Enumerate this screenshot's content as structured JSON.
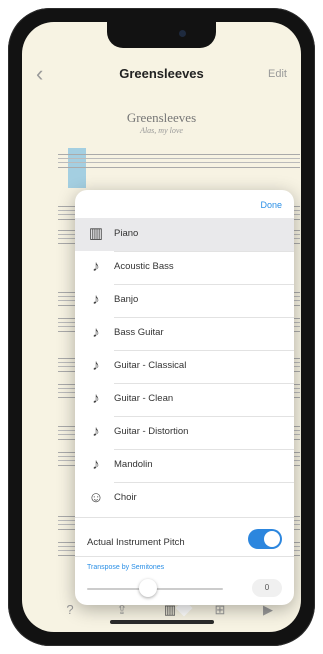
{
  "nav": {
    "back_icon": "chevron-left-icon",
    "title": "Greensleeves",
    "edit_label": "Edit"
  },
  "score": {
    "title": "Greensleeves",
    "subtitle": "Alas, my love"
  },
  "popover": {
    "done_label": "Done",
    "instruments": [
      {
        "label": "Piano",
        "icon": "piano-keys-icon",
        "selected": true
      },
      {
        "label": "Acoustic Bass",
        "icon": "guitar-icon",
        "selected": false
      },
      {
        "label": "Banjo",
        "icon": "guitar-icon",
        "selected": false
      },
      {
        "label": "Bass Guitar",
        "icon": "guitar-icon",
        "selected": false
      },
      {
        "label": "Guitar - Classical",
        "icon": "guitar-icon",
        "selected": false
      },
      {
        "label": "Guitar - Clean",
        "icon": "guitar-icon",
        "selected": false
      },
      {
        "label": "Guitar - Distortion",
        "icon": "guitar-icon",
        "selected": false
      },
      {
        "label": "Mandolin",
        "icon": "guitar-icon",
        "selected": false
      },
      {
        "label": "Choir",
        "icon": "choir-icon",
        "selected": false
      }
    ],
    "pitch_label": "Actual Instrument Pitch",
    "pitch_enabled": true,
    "transpose_label": "Transpose by Semitones",
    "semitones_value": "0"
  },
  "toolbar": {
    "items": [
      {
        "icon": "help-icon"
      },
      {
        "icon": "share-icon"
      },
      {
        "icon": "instrument-icon",
        "active": true
      },
      {
        "icon": "mixer-icon"
      },
      {
        "icon": "play-icon"
      }
    ]
  },
  "colors": {
    "accent": "#2a8fe6",
    "toggle_on": "#2c86de",
    "paper": "#f7f3e3"
  }
}
